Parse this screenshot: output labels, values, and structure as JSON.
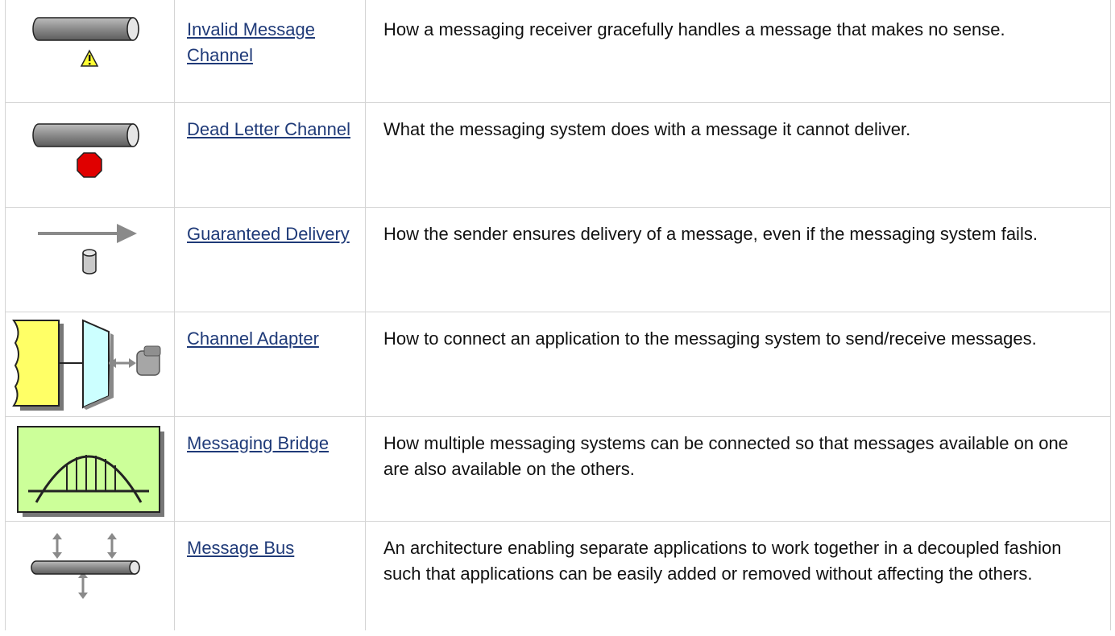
{
  "patterns": [
    {
      "icon": "invalid-message-channel-icon",
      "name": "Invalid Message Channel",
      "description": "How a messaging receiver gracefully handles a message that makes no sense."
    },
    {
      "icon": "dead-letter-channel-icon",
      "name": "Dead Letter Channel",
      "description": "What the messaging system does with a message it cannot deliver."
    },
    {
      "icon": "guaranteed-delivery-icon",
      "name": "Guaranteed Delivery",
      "description": "How the sender ensures delivery of a message, even if the messaging system fails."
    },
    {
      "icon": "channel-adapter-icon",
      "name": "Channel Adapter",
      "description": "How to connect an application to the messaging system to send/receive messages."
    },
    {
      "icon": "messaging-bridge-icon",
      "name": "Messaging Bridge",
      "description": "How multiple messaging systems can be connected so that messages available on one are also available on the others."
    },
    {
      "icon": "message-bus-icon",
      "name": "Message Bus",
      "description": "An architecture enabling separate applications to work together in a decoupled fashion such that applications can be easily added or removed without affecting the others."
    }
  ],
  "colors": {
    "link": "#1f3a78",
    "grid": "#d4d4d4",
    "warning": "#ffff33",
    "stop": "#e00000",
    "bridge_fill": "#ccff99",
    "application": "#ffff66",
    "adapter": "#ccffff"
  }
}
